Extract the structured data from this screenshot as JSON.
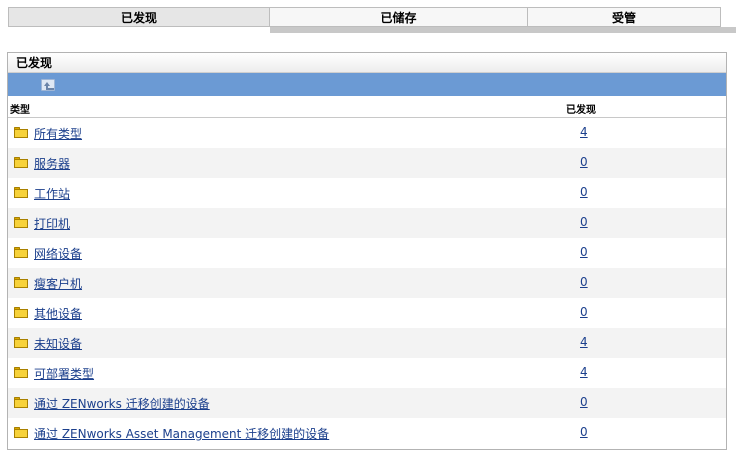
{
  "tabs": [
    {
      "label": "已发现"
    },
    {
      "label": "已储存"
    },
    {
      "label": "受管"
    }
  ],
  "panel": {
    "title": "已发现",
    "columns": {
      "type": "类型",
      "discovered": "已发现"
    },
    "rows": [
      {
        "label": "所有类型",
        "count": "4"
      },
      {
        "label": "服务器",
        "count": "0"
      },
      {
        "label": "工作站",
        "count": "0"
      },
      {
        "label": "打印机",
        "count": "0"
      },
      {
        "label": "网络设备",
        "count": "0"
      },
      {
        "label": "瘦客户机",
        "count": "0"
      },
      {
        "label": "其他设备",
        "count": "0"
      },
      {
        "label": "未知设备",
        "count": "4"
      },
      {
        "label": "可部署类型",
        "count": "4"
      },
      {
        "label": "通过 ZENworks 迁移创建的设备",
        "count": "0"
      },
      {
        "label": "通过 ZENworks Asset Management 迁移创建的设备",
        "count": "0"
      }
    ]
  },
  "icons": {
    "toolbar": "up-folder-icon",
    "row": "folder-icon"
  }
}
